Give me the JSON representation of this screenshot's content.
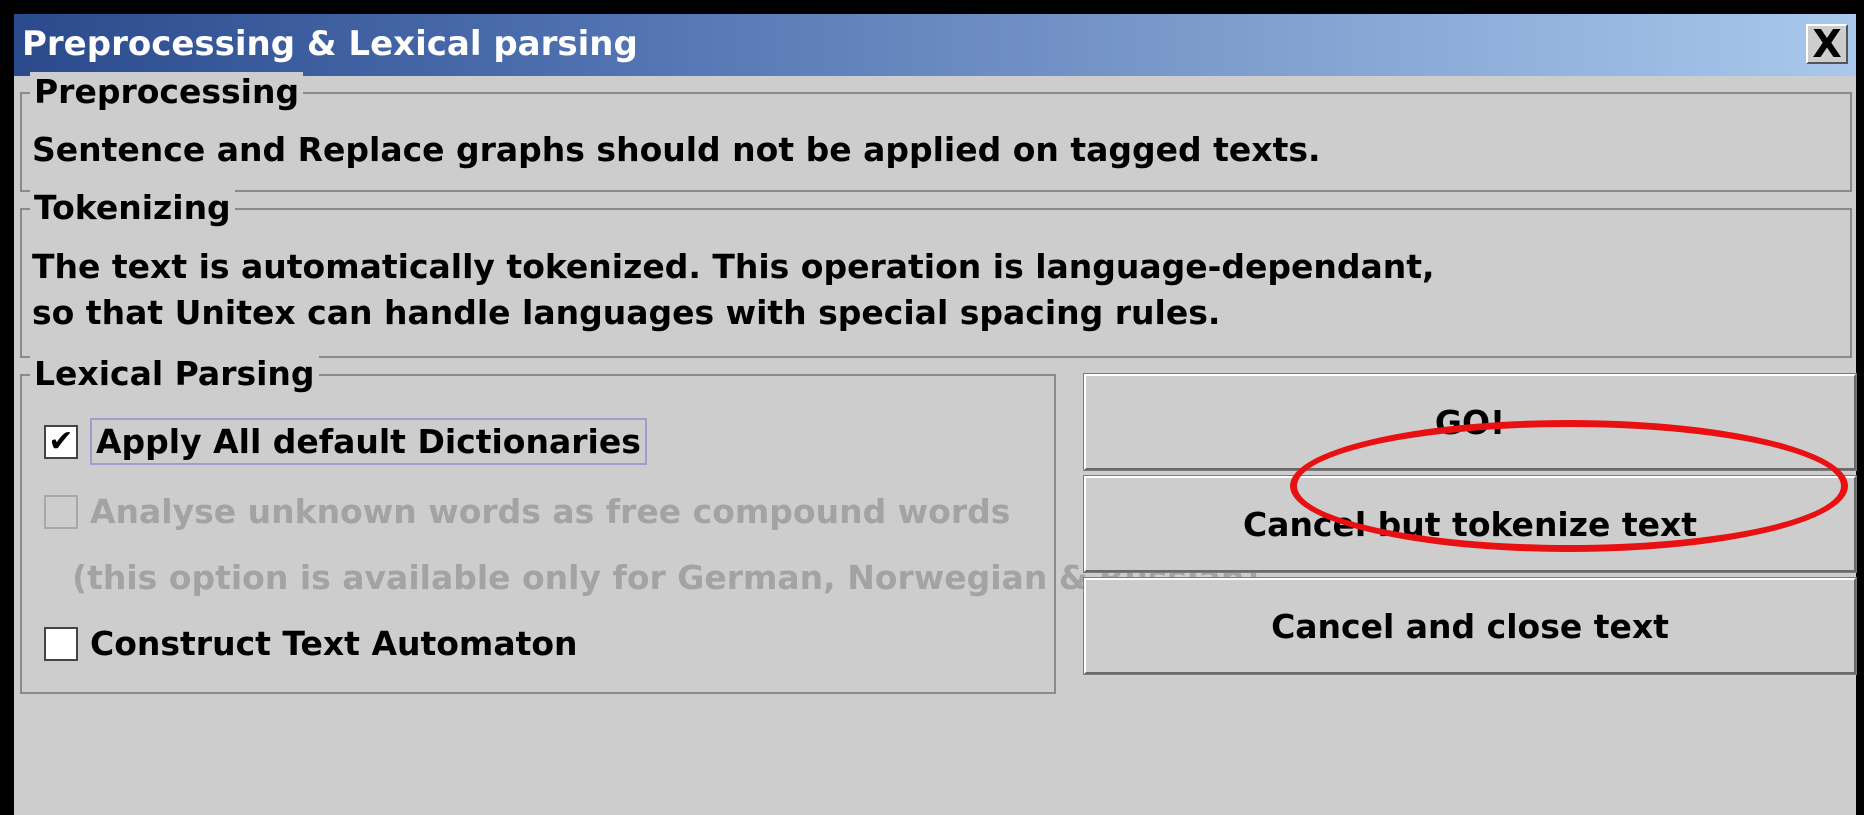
{
  "window": {
    "title": "Preprocessing & Lexical parsing",
    "close_symbol": "X"
  },
  "preprocessing": {
    "legend": "Preprocessing",
    "text": "Sentence and Replace graphs should not be applied on tagged texts."
  },
  "tokenizing": {
    "legend": "Tokenizing",
    "line1": "The text is automatically tokenized. This operation is language-dependant,",
    "line2": "so that Unitex can handle languages with special spacing rules."
  },
  "lexical": {
    "legend": "Lexical Parsing",
    "apply_dictionaries": {
      "label": "Apply All default Dictionaries",
      "checked": true,
      "check_mark": "✔"
    },
    "free_compound": {
      "label": "Analyse unknown words as free compound words",
      "checked": false,
      "enabled": false
    },
    "free_compound_note": "(this option is available only for German, Norwegian & Russian)",
    "text_automaton": {
      "label": "Construct Text Automaton",
      "checked": false
    }
  },
  "buttons": {
    "go": "GO!",
    "cancel_tokenize": "Cancel but tokenize text",
    "cancel_close": "Cancel and close text"
  },
  "annotation_color": "#e81010"
}
